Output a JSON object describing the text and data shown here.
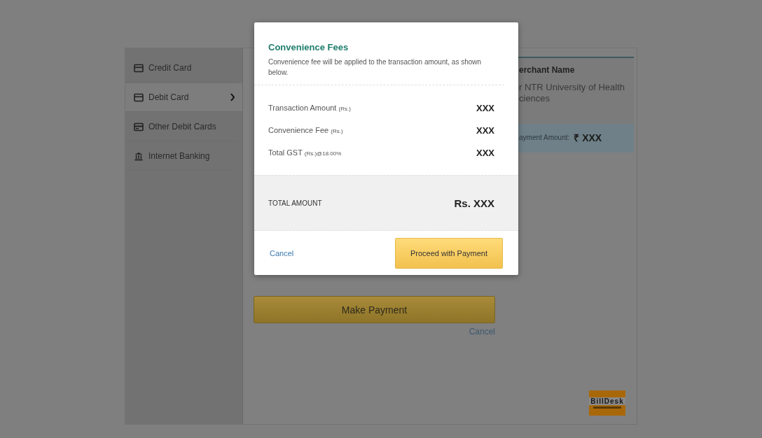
{
  "sidebar": {
    "items": [
      {
        "label": "Credit Card",
        "kind": "card",
        "selected": false
      },
      {
        "label": "Debit Card",
        "kind": "card",
        "selected": true
      },
      {
        "label": "Other Debit Cards",
        "kind": "card-alt",
        "selected": false
      },
      {
        "label": "Internet Banking",
        "kind": "bank",
        "selected": false
      }
    ]
  },
  "payment": {
    "button": "Make Payment",
    "cancel": "Cancel"
  },
  "merchant": {
    "heading": "erchant Name",
    "name_lines": [
      "r NTR University of Health",
      "ciences"
    ],
    "amount_label": "ayment Amount:",
    "amount": "₹ XXX"
  },
  "logo": {
    "text": "BillDesk"
  },
  "modal": {
    "title": "Convenience Fees",
    "description": "Convenience fee will be applied to the transaction amount, as shown below.",
    "rows": [
      {
        "label": "Transaction Amount",
        "unit": "(Rs.)",
        "note": "",
        "value": "XXX"
      },
      {
        "label": "Convenience Fee",
        "unit": "(Rs.)",
        "note": "",
        "value": "XXX"
      },
      {
        "label": "Total GST",
        "unit": "(Rs.)",
        "note": "@18.00%",
        "value": "XXX"
      }
    ],
    "total": {
      "label": "TOTAL AMOUNT",
      "value": "Rs. XXX"
    },
    "cancel": "Cancel",
    "proceed": "Proceed with Payment"
  }
}
